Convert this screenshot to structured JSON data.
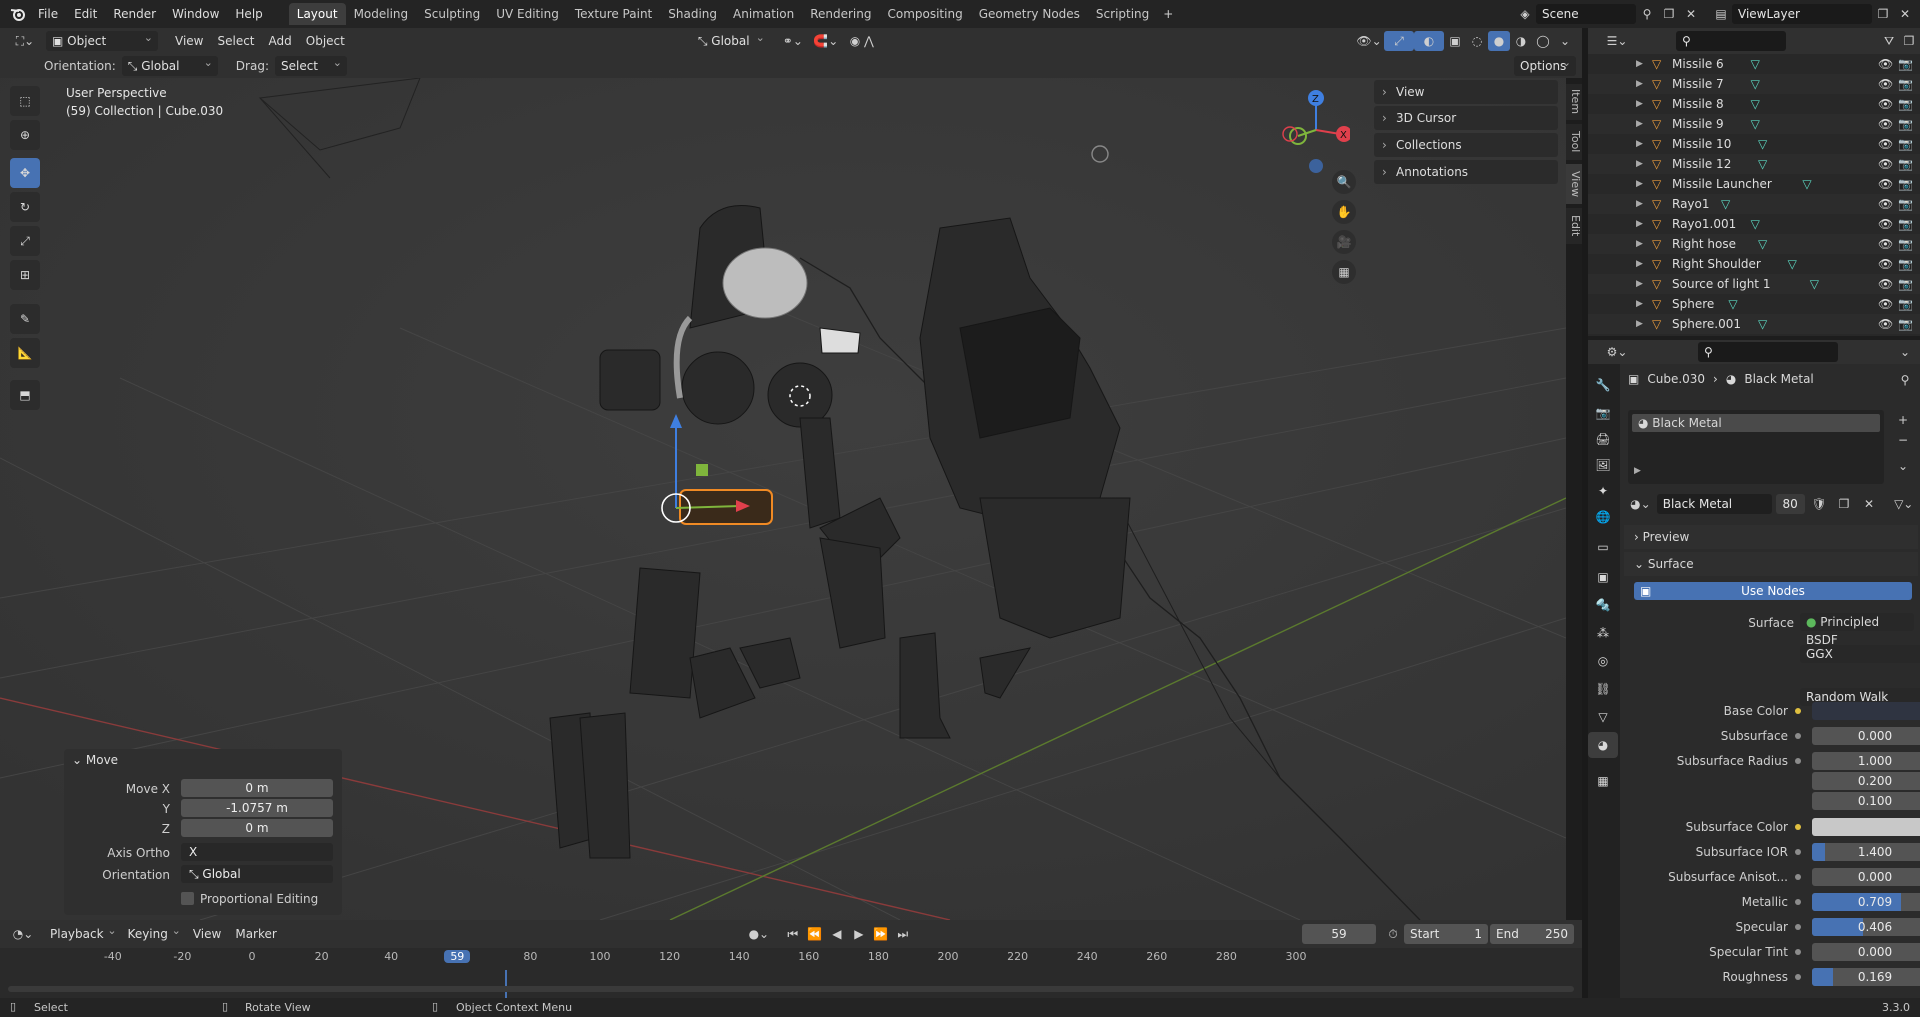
{
  "topbar": {
    "menus": [
      "File",
      "Edit",
      "Render",
      "Window",
      "Help"
    ],
    "workspaces": [
      "Layout",
      "Modeling",
      "Sculpting",
      "UV Editing",
      "Texture Paint",
      "Shading",
      "Animation",
      "Rendering",
      "Compositing",
      "Geometry Nodes",
      "Scripting"
    ],
    "active_workspace": "Layout",
    "scene": "Scene",
    "view_layer": "ViewLayer"
  },
  "viewport_header": {
    "mode": "Object Mode",
    "menus": [
      "View",
      "Select",
      "Add",
      "Object"
    ],
    "transform_orientation": "Global",
    "orientation_label": "Orientation:",
    "orientation_value": "Global",
    "drag_label": "Drag:",
    "drag_value": "Select Box",
    "options": "Options"
  },
  "viewport": {
    "perspective": "User Perspective",
    "collection": "(59) Collection | Cube.030",
    "gizmo_axes": {
      "x": "X",
      "y": "Y",
      "z": "Z"
    },
    "sidebar_panels": [
      "View",
      "3D Cursor",
      "Collections",
      "Annotations"
    ],
    "sidebar_tabs": [
      "Item",
      "Tool",
      "View",
      "Edit"
    ]
  },
  "move_panel": {
    "title": "Move",
    "move_x_label": "Move X",
    "move_x": "0 m",
    "y_label": "Y",
    "y": "-1.0757 m",
    "z_label": "Z",
    "z": "0 m",
    "axis_ortho_label": "Axis Ortho",
    "axis_ortho": "X",
    "orientation_label": "Orientation",
    "orientation": "Global",
    "proportional": "Proportional Editing"
  },
  "outliner": {
    "items": [
      "Missile 6",
      "Missile 7",
      "Missile 8",
      "Missile 9",
      "Missile 10",
      "Missile 12",
      "Missile Launcher",
      "Rayo1",
      "Rayo1.001",
      "Right hose",
      "Right Shoulder",
      "Source of light 1",
      "Sphere",
      "Sphere.001"
    ]
  },
  "properties": {
    "breadcrumb_object": "Cube.030",
    "breadcrumb_material": "Black Metal",
    "slot": "Black Metal",
    "material_name": "Black Metal",
    "users": "80",
    "preview": "Preview",
    "surface_section": "Surface",
    "use_nodes": "Use Nodes",
    "surface_label": "Surface",
    "surface_value": "Principled BSDF",
    "distribution": "GGX",
    "subsurface_method": "Random Walk",
    "fields": [
      {
        "label": "Base Color",
        "value": "",
        "type": "color",
        "color": "#2f3441"
      },
      {
        "label": "Subsurface",
        "value": "0.000",
        "fill": 0
      },
      {
        "label": "Subsurface Radius",
        "value": "1.000",
        "fill": 0
      },
      {
        "label": "",
        "value": "0.200",
        "fill": 0
      },
      {
        "label": "",
        "value": "0.100",
        "fill": 0
      },
      {
        "label": "Subsurface Color",
        "value": "",
        "type": "color",
        "color": "#c8c8c8"
      },
      {
        "label": "Subsurface IOR",
        "value": "1.400",
        "fill": 0.1
      },
      {
        "label": "Subsurface Anisot...",
        "value": "0.000",
        "fill": 0
      },
      {
        "label": "Metallic",
        "value": "0.709",
        "fill": 0.709
      },
      {
        "label": "Specular",
        "value": "0.406",
        "fill": 0.406
      },
      {
        "label": "Specular Tint",
        "value": "0.000",
        "fill": 0
      },
      {
        "label": "Roughness",
        "value": "0.169",
        "fill": 0.169
      }
    ]
  },
  "timeline": {
    "menus": [
      "Playback",
      "Keying",
      "View",
      "Marker"
    ],
    "current_frame": "59",
    "start_label": "Start",
    "start": "1",
    "end_label": "End",
    "end": "250",
    "ticks": [
      "-40",
      "-20",
      "0",
      "20",
      "40",
      "59",
      "80",
      "100",
      "120",
      "140",
      "160",
      "180",
      "200",
      "220",
      "240",
      "260",
      "280",
      "300"
    ]
  },
  "statusbar": {
    "select": "Select",
    "rotate": "Rotate View",
    "context": "Object Context Menu",
    "version": "3.3.0"
  },
  "colors": {
    "accent": "#4772b3",
    "selected": "#f08a24",
    "x_axis": "#e0404c",
    "y_axis": "#7fb53c",
    "z_axis": "#3f7fe0"
  }
}
